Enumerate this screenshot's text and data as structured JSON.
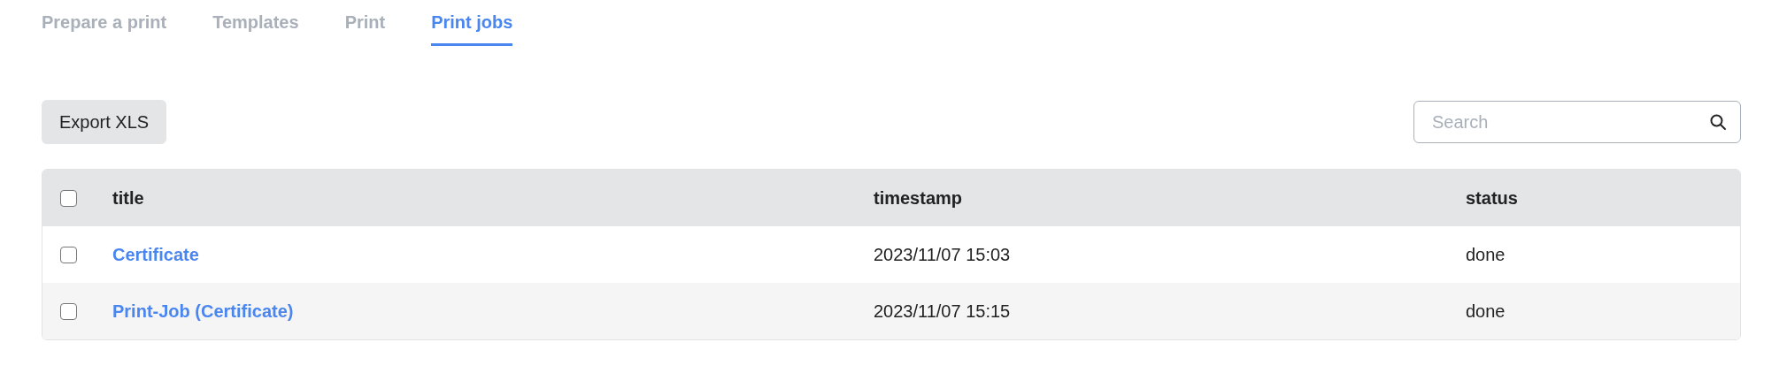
{
  "tabs": [
    {
      "label": "Prepare a print",
      "selected": false
    },
    {
      "label": "Templates",
      "selected": false
    },
    {
      "label": "Print",
      "selected": false
    },
    {
      "label": "Print jobs",
      "selected": true
    }
  ],
  "toolbar": {
    "export_button": "Export XLS",
    "search": {
      "placeholder": "Search"
    }
  },
  "table": {
    "select_all_checked": false,
    "columns": [
      "title",
      "timestamp",
      "status"
    ],
    "rows": [
      {
        "checked": false,
        "title": "Certificate",
        "timestamp": "2023/11/07 15:03",
        "status": "done"
      },
      {
        "checked": false,
        "title": "Print-Job (Certificate)",
        "timestamp": "2023/11/07 15:15",
        "status": "done"
      }
    ]
  }
}
